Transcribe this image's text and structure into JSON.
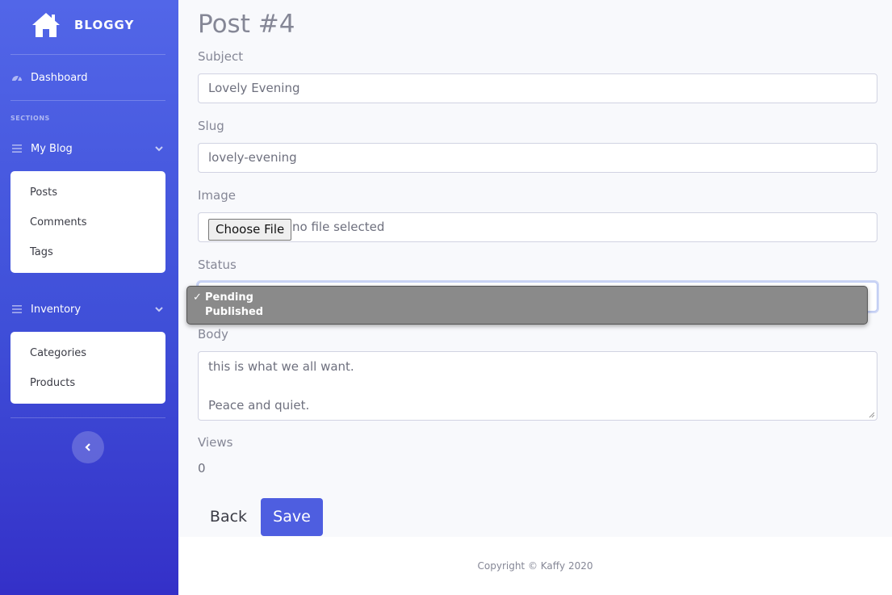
{
  "sidebar": {
    "brand": "BLOGGY",
    "dashboard_label": "Dashboard",
    "section_heading": "SECTIONS",
    "groups": [
      {
        "label": "My Blog",
        "items": [
          "Posts",
          "Comments",
          "Tags"
        ]
      },
      {
        "label": "Inventory",
        "items": [
          "Categories",
          "Products"
        ]
      }
    ]
  },
  "form": {
    "title": "Post #4",
    "subject_label": "Subject",
    "subject_value": "Lovely Evening",
    "slug_label": "Slug",
    "slug_value": "lovely-evening",
    "image_label": "Image",
    "file_button": "Choose File",
    "file_status": "no file selected",
    "status_label": "Status",
    "status_options": [
      "Pending",
      "Published"
    ],
    "status_selected": "Pending",
    "body_label": "Body",
    "body_lines": [
      "this is what we all want.",
      "Peace and quiet."
    ],
    "views_label": "Views",
    "views_value": "0",
    "back_label": "Back",
    "save_label": "Save"
  },
  "footer": {
    "text": "Copyright © Kaffy 2020"
  },
  "colors": {
    "accent": "#4e5ee0",
    "sidebar_top": "#5266e8",
    "sidebar_bottom": "#3430c8"
  },
  "icons": [
    "home-icon",
    "dashboard-icon",
    "menu-icon",
    "chevron-down-icon",
    "chevron-left-icon",
    "check-icon"
  ]
}
